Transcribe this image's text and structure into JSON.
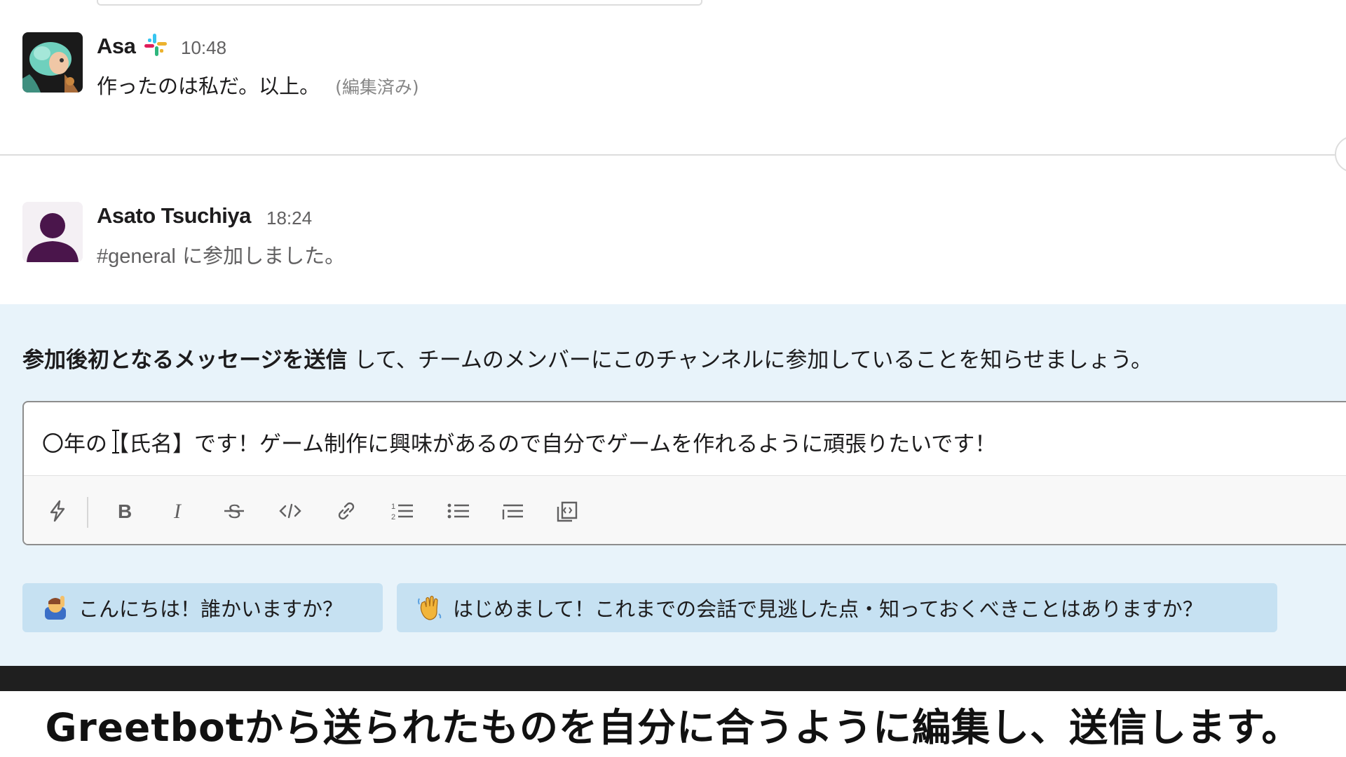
{
  "messages": [
    {
      "user": "Asa",
      "time": "10:48",
      "text": "作ったのは私だ。以上。",
      "edited_label": "(編集済み)",
      "icon": "slack-logo-icon"
    },
    {
      "user": "Asato Tsuchiya",
      "time": "18:24",
      "channel": "#general",
      "text": "に参加しました。",
      "icon": "default-avatar-icon"
    }
  ],
  "greetbot": {
    "prompt_bold": "参加後初となるメッセージを送信",
    "prompt_rest": "して、チームのメンバーにこのチャンネルに参加していることを知らせましょう。",
    "composer_value": "〇年の【氏名】です！ゲーム制作に興味があるので自分でゲームを作れるように頑張りたいです！",
    "toolbar_icons": [
      "shortcuts-icon",
      "bold-icon",
      "italic-icon",
      "strikethrough-icon",
      "code-icon",
      "link-icon",
      "ordered-list-icon",
      "bulleted-list-icon",
      "blockquote-icon",
      "code-block-icon"
    ],
    "suggestions": [
      {
        "emoji": "raising-hand-emoji",
        "label": "こんにちは！誰かいますか？"
      },
      {
        "emoji": "waving-hand-emoji",
        "label": "はじめまして！これまでの会話で見逃した点・知っておくべきことはありますか？"
      }
    ]
  },
  "caption": "Greetbotから送られたものを自分に合うように編集し、送信します。",
  "colors": {
    "greet_bg": "#e8f3fa",
    "chip_bg": "#c6e1f2",
    "avatar_purple": "#4a154b"
  }
}
